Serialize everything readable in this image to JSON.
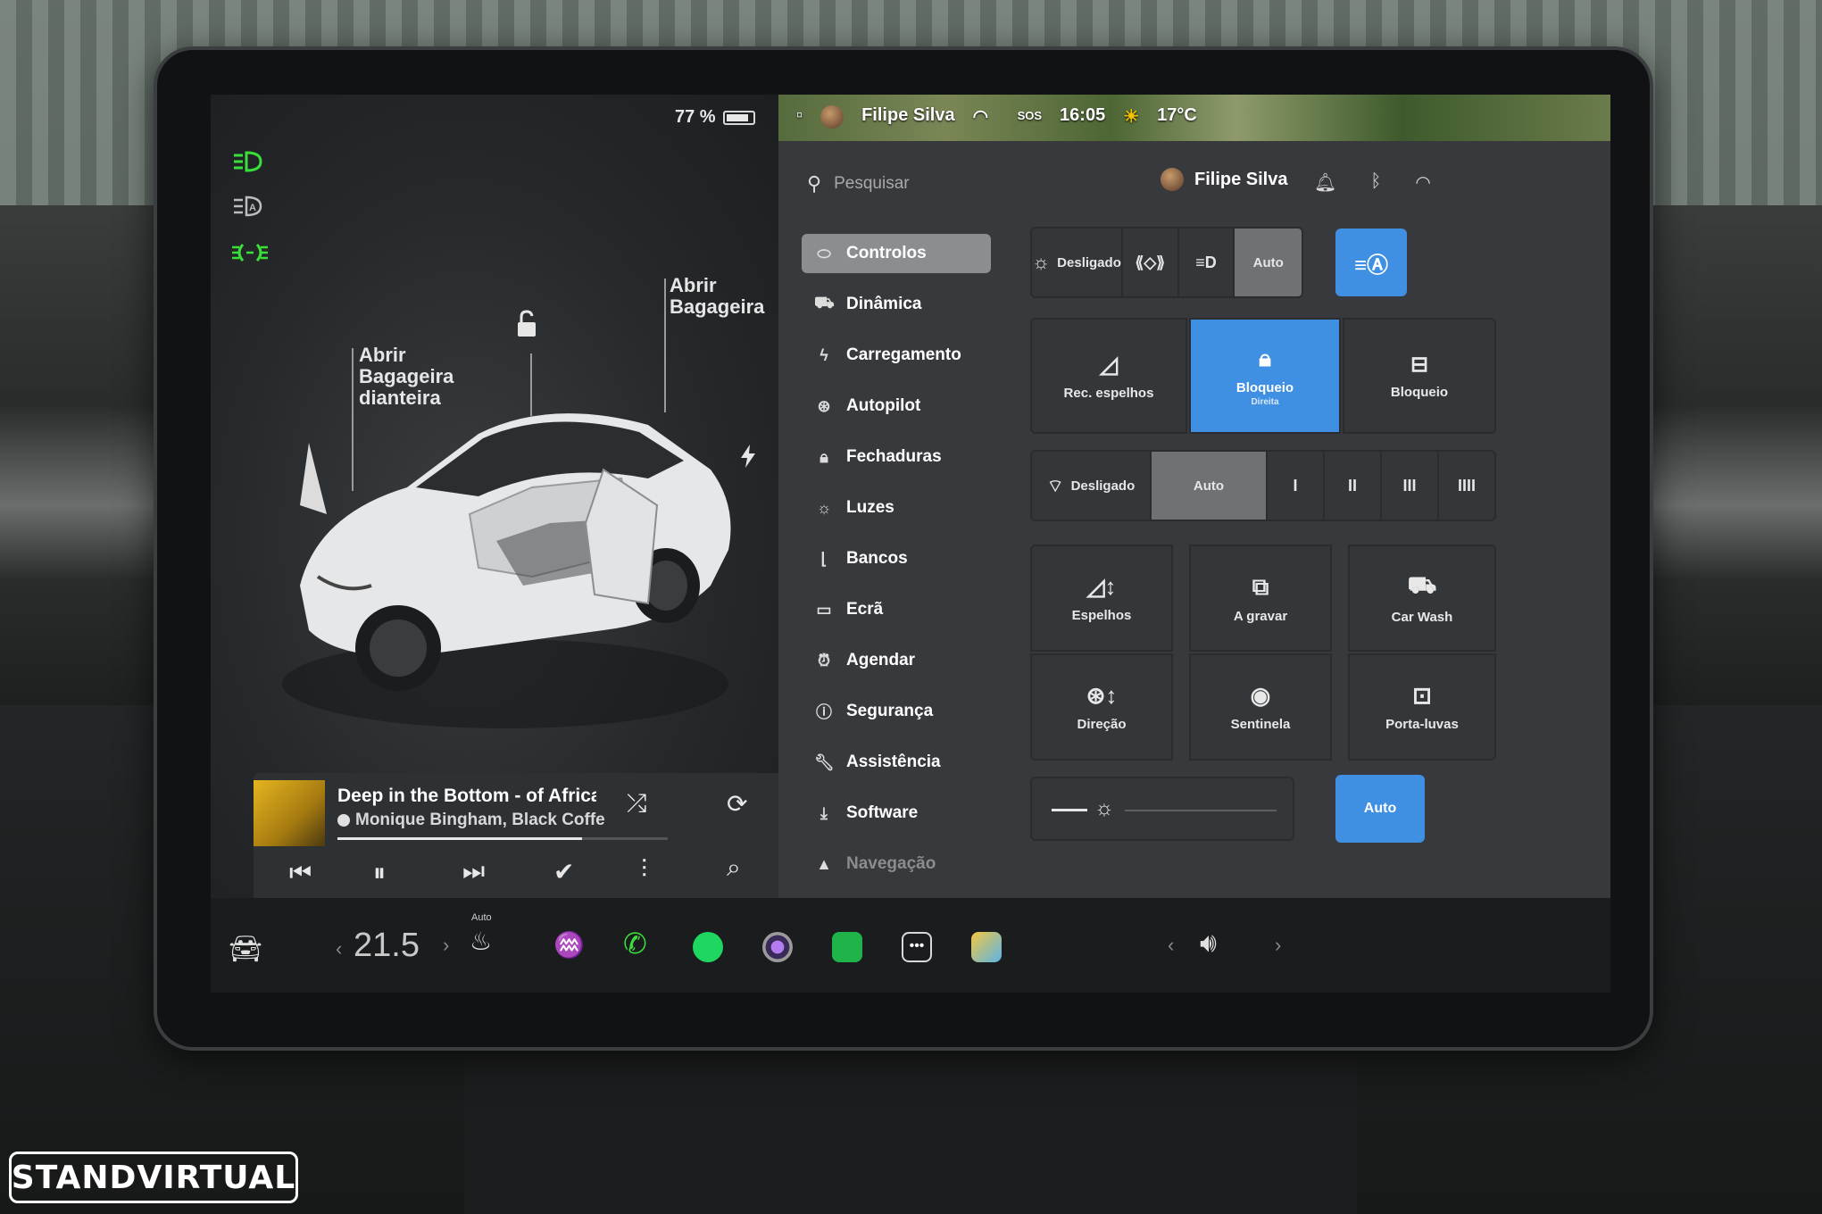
{
  "status": {
    "battery": "77 %",
    "user_name": "Filipe Silva",
    "sos": "SOS",
    "time": "16:05",
    "temperature": "17°C"
  },
  "left": {
    "callout_front_trunk": "Abrir Bagageira dianteira",
    "callout_trunk": "Abrir Bagageira",
    "light_icons": [
      "headlights-on-icon",
      "auto-headlights-icon",
      "fog-lights-icon"
    ]
  },
  "music": {
    "title": "Deep in the Bottom - of Africa",
    "artist": "Monique Bingham, Black Coffee",
    "progress": 0.74
  },
  "search": {
    "placeholder": "Pesquisar"
  },
  "header": {
    "user_name": "Filipe Silva"
  },
  "menu": {
    "items": [
      {
        "label": "Controlos",
        "icon": "toggle-icon"
      },
      {
        "label": "Dinâmica",
        "icon": "car-icon"
      },
      {
        "label": "Carregamento",
        "icon": "bolt-icon"
      },
      {
        "label": "Autopilot",
        "icon": "steering-wheel-icon"
      },
      {
        "label": "Fechaduras",
        "icon": "lock-icon"
      },
      {
        "label": "Luzes",
        "icon": "sun-icon"
      },
      {
        "label": "Bancos",
        "icon": "seat-icon"
      },
      {
        "label": "Ecrã",
        "icon": "display-icon"
      },
      {
        "label": "Agendar",
        "icon": "alarm-clock-icon"
      },
      {
        "label": "Segurança",
        "icon": "info-circle-icon"
      },
      {
        "label": "Assistência",
        "icon": "wrench-icon"
      },
      {
        "label": "Software",
        "icon": "download-icon"
      },
      {
        "label": "Navegação",
        "icon": "navigation-arrow-icon"
      }
    ]
  },
  "controls": {
    "lights_row": {
      "off_label": "Desligado",
      "auto_label": "Auto"
    },
    "mirror_fold_label": "Rec. espelhos",
    "child_lock_label": "Bloqueio",
    "child_lock_sub": "Direita",
    "glovebox_lock_label": "Bloqueio",
    "wiper_row": {
      "off_label": "Desligado",
      "auto_label": "Auto",
      "speeds": [
        "I",
        "II",
        "III",
        "IIII"
      ]
    },
    "tiles": [
      {
        "label": "Espelhos",
        "icon": "mirror-adjust-icon"
      },
      {
        "label": "A gravar",
        "icon": "dashcam-icon"
      },
      {
        "label": "Car Wash",
        "icon": "car-wash-icon"
      },
      {
        "label": "Direção",
        "icon": "steering-adjust-icon"
      },
      {
        "label": "Sentinela",
        "icon": "sentry-icon"
      },
      {
        "label": "Porta-luvas",
        "icon": "glovebox-icon"
      }
    ],
    "brightness_auto_label": "Auto"
  },
  "bottom": {
    "temp_value": "21.5",
    "seat_heat_label": "Auto"
  },
  "watermark": "STANDVIRTUAL",
  "colors": {
    "accent_blue": "#3f8fe2",
    "light_green": "#3adf3a",
    "spotify_green": "#1ed760"
  }
}
